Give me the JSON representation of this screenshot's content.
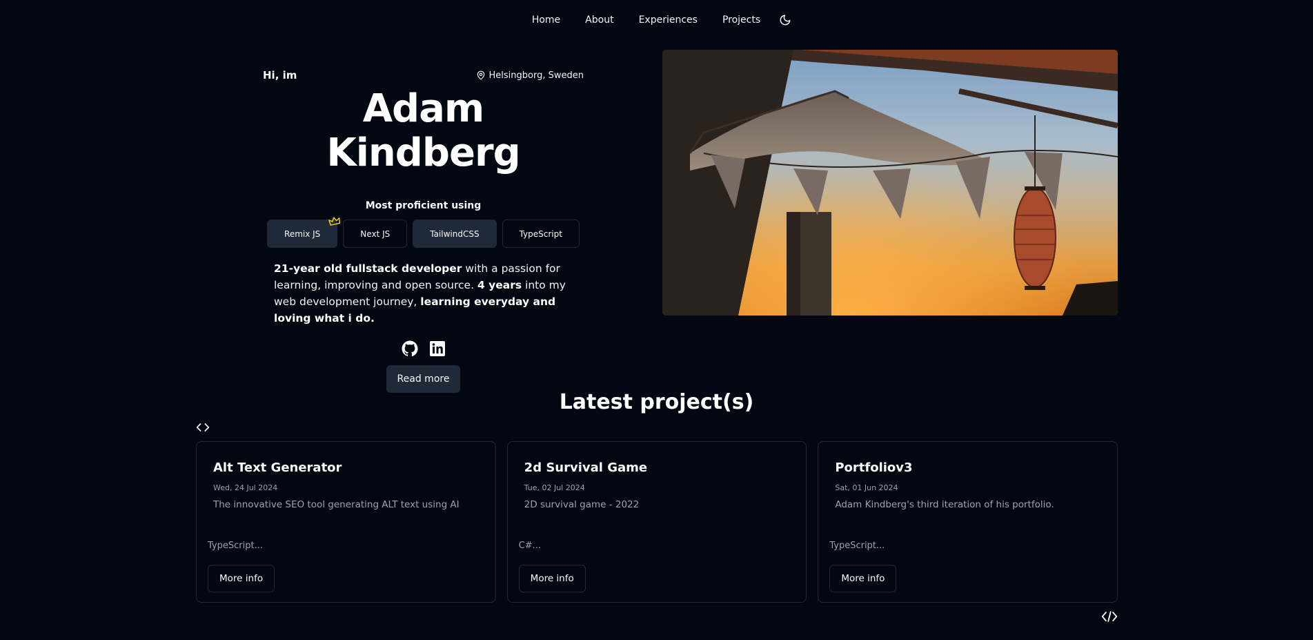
{
  "nav": {
    "items": [
      {
        "label": "Home"
      },
      {
        "label": "About"
      },
      {
        "label": "Experiences"
      },
      {
        "label": "Projects"
      }
    ],
    "theme_icon": "moon-icon"
  },
  "hero": {
    "greeting": "Hi, im",
    "location": "Helsingborg, Sweden",
    "name": "Adam Kindberg",
    "proficient_label": "Most proficient using",
    "skills": [
      {
        "label": "Remix JS",
        "filled": true,
        "crown": true
      },
      {
        "label": "Next JS",
        "filled": false
      },
      {
        "label": "TailwindCSS",
        "filled": true
      },
      {
        "label": "TypeScript",
        "filled": false
      }
    ],
    "bio": {
      "p1_bold": "21-year old fullstack developer",
      "p2": " with a passion for learning, improving and open source. ",
      "p3_bold": "4 years",
      "p4": " into my web development journey, ",
      "p5_bold": "learning everyday and loving what i do."
    },
    "socials": [
      "github-icon",
      "linkedin-icon"
    ],
    "read_more": "Read more"
  },
  "projects": {
    "title": "Latest project(s)",
    "items": [
      {
        "title": "Alt Text Generator",
        "date": "Wed, 24 Jul 2024",
        "description": "The innovative SEO tool generating ALT text using AI",
        "tags": "TypeScript...",
        "button": "More info"
      },
      {
        "title": "2d Survival Game",
        "date": "Tue, 02 Jul 2024",
        "description": "2D survival game - 2022",
        "tags": "C#...",
        "button": "More info"
      },
      {
        "title": "Portfoliov3",
        "date": "Sat, 01 Jun 2024",
        "description": "Adam Kindberg's third iteration of his portfolio.",
        "tags": "TypeScript...",
        "button": "More info"
      }
    ]
  },
  "colors": {
    "background": "#030712",
    "surface": "#1f2937",
    "muted_text": "#9ca3af",
    "crown": "#facc15"
  }
}
